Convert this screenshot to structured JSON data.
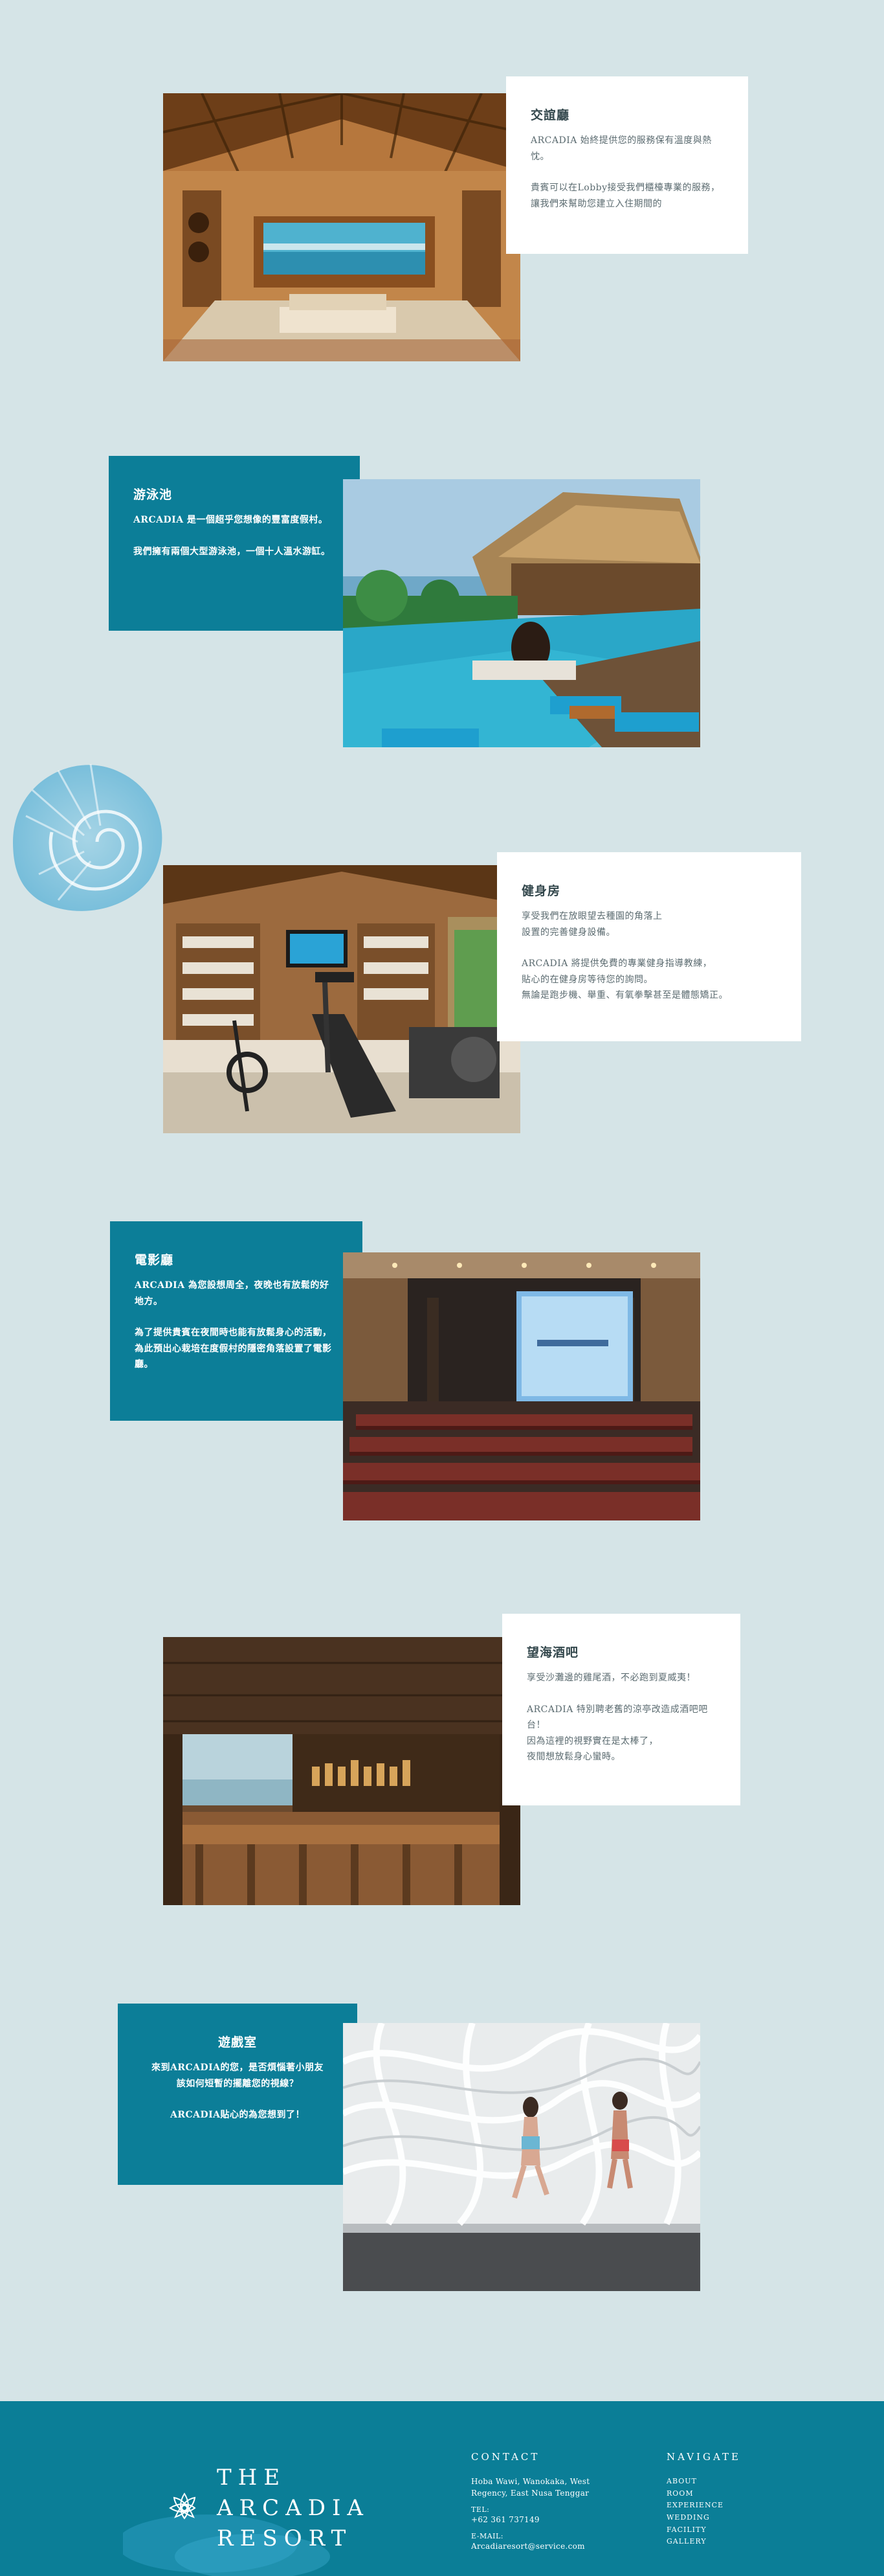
{
  "sections": [
    {
      "title": "交誼廳",
      "paragraphs": [
        "ARCADIA 始終提供您的服務保有溫度與熱忱。",
        "貴賓可以在Lobby接受我們櫃檯專業的服務，讓我們來幫助您建立入住期間的"
      ]
    },
    {
      "title": "游泳池",
      "paragraphs": [
        "ARCADIA 是一個超乎您想像的豐富度假村。",
        "我們擁有兩個大型游泳池，一個十人溫水游缸。"
      ]
    },
    {
      "title": "健身房",
      "paragraphs": [
        "享受我們在放眼望去種園的角落上\n設置的完善健身設備。",
        "ARCADIA 將提供免費的專業健身指導教練，\n貼心的在健身房等待您的詢問。\n無論是跑步機、舉重、有氧拳擊甚至是體態矯正。"
      ]
    },
    {
      "title": "電影廳",
      "paragraphs": [
        "ARCADIA 為您設想周全，夜晚也有放鬆的好地方。",
        "為了提供貴賓在夜間時也能有放鬆身心的活動，\n為此預出心栽培在度假村的隱密角落設置了電影廳。"
      ]
    },
    {
      "title": "望海酒吧",
      "paragraphs": [
        "享受沙灘邊的雞尾酒，不必跑到夏威夷！",
        "ARCADIA 特別聘老舊的涼亭改造成酒吧吧台！\n因為這裡的視野實在是太棒了，\n夜間想放鬆身心蠻時。"
      ]
    },
    {
      "title": "遊戲室",
      "paragraphs": [
        "來到ARCADIA的您，是否煩惱著小朋友\n該如何短暫的擺離您的視線？",
        "ARCADIA貼心的為您想到了！"
      ]
    }
  ],
  "footer": {
    "brand": "THE\nARCADIA\nRESORT",
    "contact_heading": "CONTACT",
    "address": "Hoba Wawi, Wanokaka, West Regency, East Nusa Tenggar",
    "tel_label": "TEL:",
    "tel": "+62 361 737149",
    "email_label": "E-MAIL:",
    "email": "Arcadiaresort@service.com",
    "navigate_heading": "NAVIGATE",
    "nav_items": [
      "ABOUT",
      "ROOM",
      "EXPERIENCE",
      "WEDDING",
      "FACILITY",
      "GALLERY"
    ]
  },
  "colors": {
    "page_background": "#d5e4e7",
    "teal_card": "#0c7e98",
    "footer": "#0b7e97",
    "white_card": "#ffffff"
  }
}
